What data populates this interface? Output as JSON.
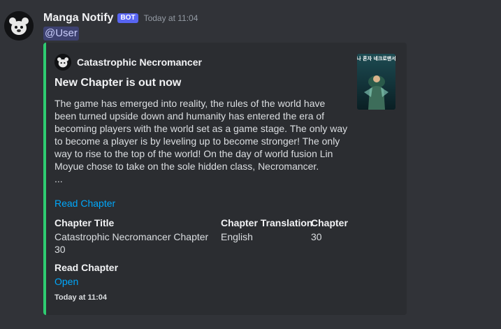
{
  "message": {
    "username": "Manga Notify",
    "bot_tag": "BOT",
    "timestamp": "Today at 11:04",
    "mention": "@User"
  },
  "embed": {
    "accent_color": "#2ecc71",
    "author_name": "Catastrophic Necromancer",
    "title": "New Chapter is out now",
    "description": "The game has emerged into reality, the rules of the world have been turned upside down and humanity has entered the era of becoming players with the world set as a game stage. The only way to become a player is by leveling up to become stronger! The only way to rise to the top of the world! On the day of world fusion Lin Moyue chose to take on the sole hidden class, Necromancer.",
    "ellipsis": "...",
    "link_text": "Read Chapter",
    "thumbnail_text": "나 혼자 네크로맨서",
    "fields": [
      {
        "name": "Chapter Title",
        "value": "Catastrophic Necromancer Chapter 30"
      },
      {
        "name": "Chapter Translation",
        "value": "English"
      },
      {
        "name": "Chapter",
        "value": "30"
      },
      {
        "name": "Read Chapter",
        "value": "Open"
      }
    ],
    "footer": "Today at 11:04"
  },
  "colors": {
    "background": "#313338",
    "embed_background": "#2b2d31",
    "link": "#00a8fc",
    "bot_tag": "#5865f2"
  },
  "icons": {
    "avatar": "bot-avatar-icon",
    "author": "author-icon",
    "thumbnail": "manga-cover-thumbnail"
  }
}
